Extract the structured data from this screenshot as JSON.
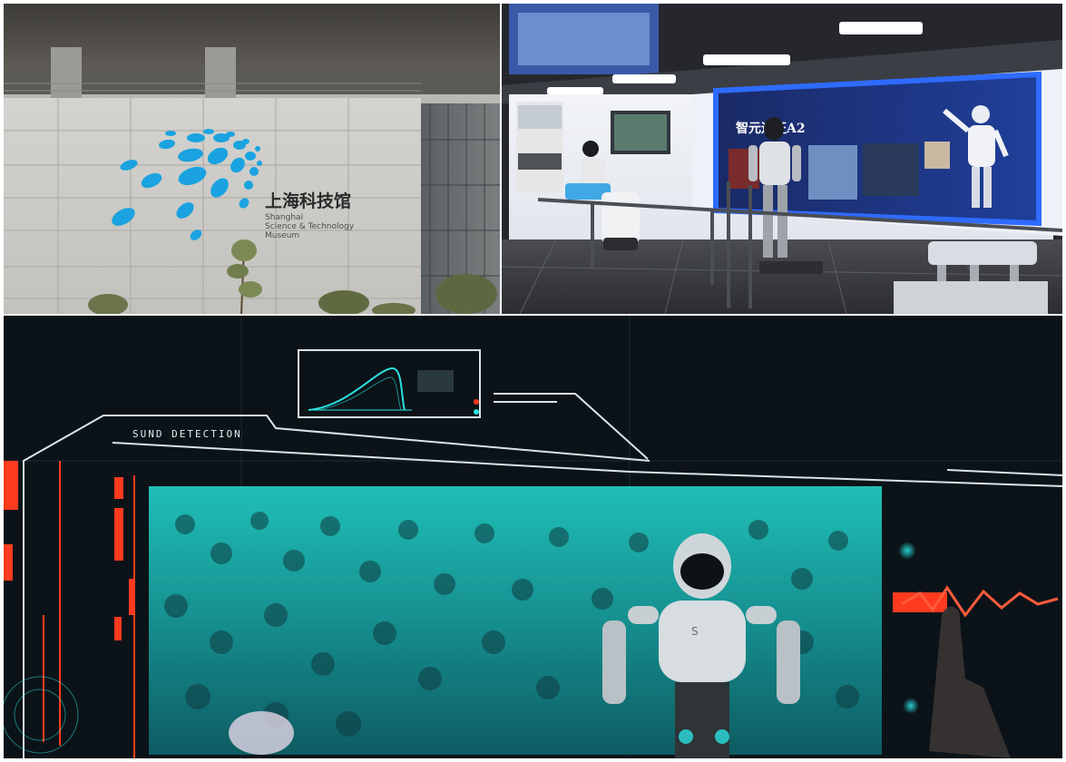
{
  "museum_facade": {
    "sign_cn": "上海科技馆",
    "sign_en_line1": "Shanghai",
    "sign_en_line2": "Science & Technology",
    "sign_en_line3": "Museum",
    "logo_color": "#1aa3e0"
  },
  "robot_exhibit": {
    "banner_title": "智元远征A2",
    "accent_color": "#2e6bff"
  },
  "detection_screen": {
    "hud_title": "SUND DETECTION",
    "hud_color": "#ff3b1f",
    "scan_color": "#2be0e0"
  }
}
